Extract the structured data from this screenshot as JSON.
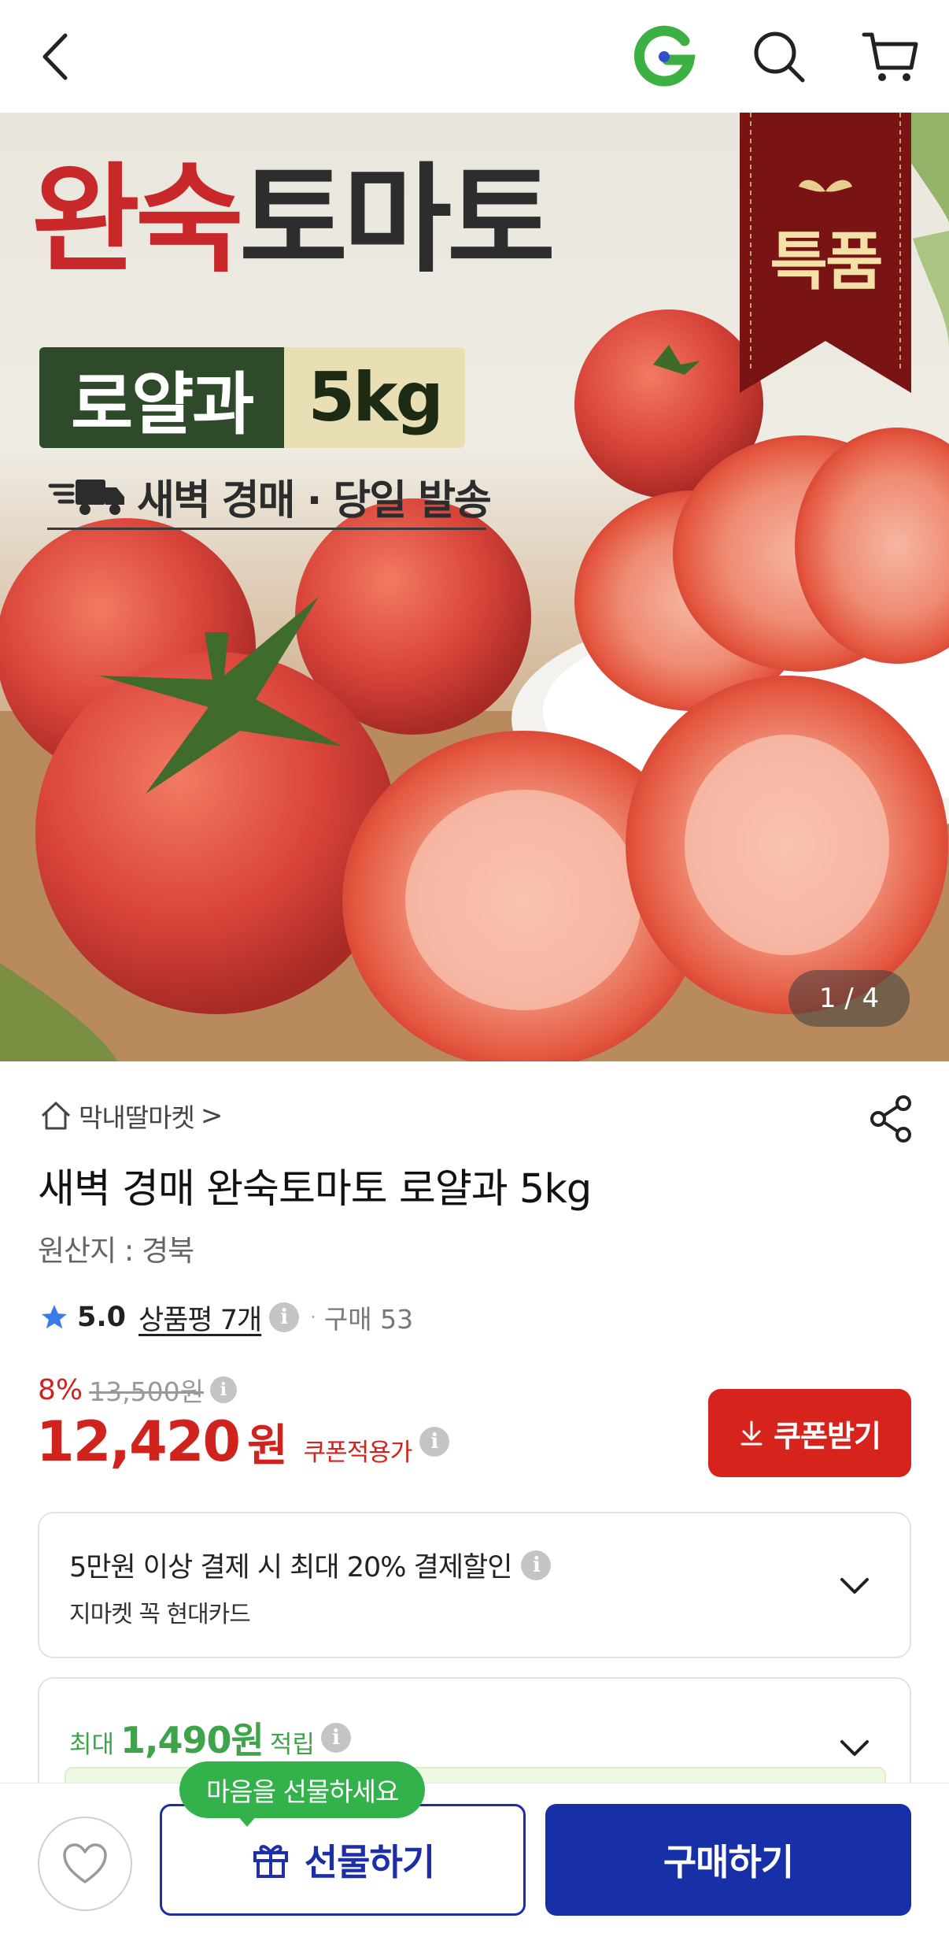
{
  "header": {
    "back_icon": "chevron-left-icon",
    "brand_icon": "gmarket-g-icon",
    "search_icon": "search-icon",
    "cart_icon": "cart-icon"
  },
  "hero": {
    "title_red": "완숙",
    "title_dark": "토마토",
    "badge_left": "로얄과",
    "badge_right": "5kg",
    "subtitle": "새벽 경매 · 당일 발송",
    "ribbon_text": "특품",
    "page_indicator": "1 / 4"
  },
  "product": {
    "shop_name": "막내딸마켓",
    "shop_chevron": ">",
    "title": "새벽 경매 완숙토마토 로얄과 5kg",
    "origin": "원산지 : 경북",
    "rating": "5.0",
    "review_label": "상품평 7개",
    "purchase_label": "구매 53",
    "discount": "8%",
    "original_price": "13,500원",
    "price": "12,420",
    "price_unit": "원",
    "coupon_price_label": "쿠폰적용가",
    "coupon_button": "쿠폰받기"
  },
  "benefits": {
    "card_discount": "5만원 이상 결제 시 최대 20% 결제할인",
    "card_name": "지마켓 꼭 현대카드",
    "points_prefix": "최대",
    "points_amount": "1,490원",
    "points_suffix": "적립"
  },
  "bottom_bar": {
    "tooltip": "마음을 선물하세요",
    "gift_button": "선물하기",
    "buy_button": "구매하기"
  },
  "colors": {
    "accent_red": "#d6231c",
    "primary_blue": "#1730a8",
    "green": "#33b14b"
  }
}
